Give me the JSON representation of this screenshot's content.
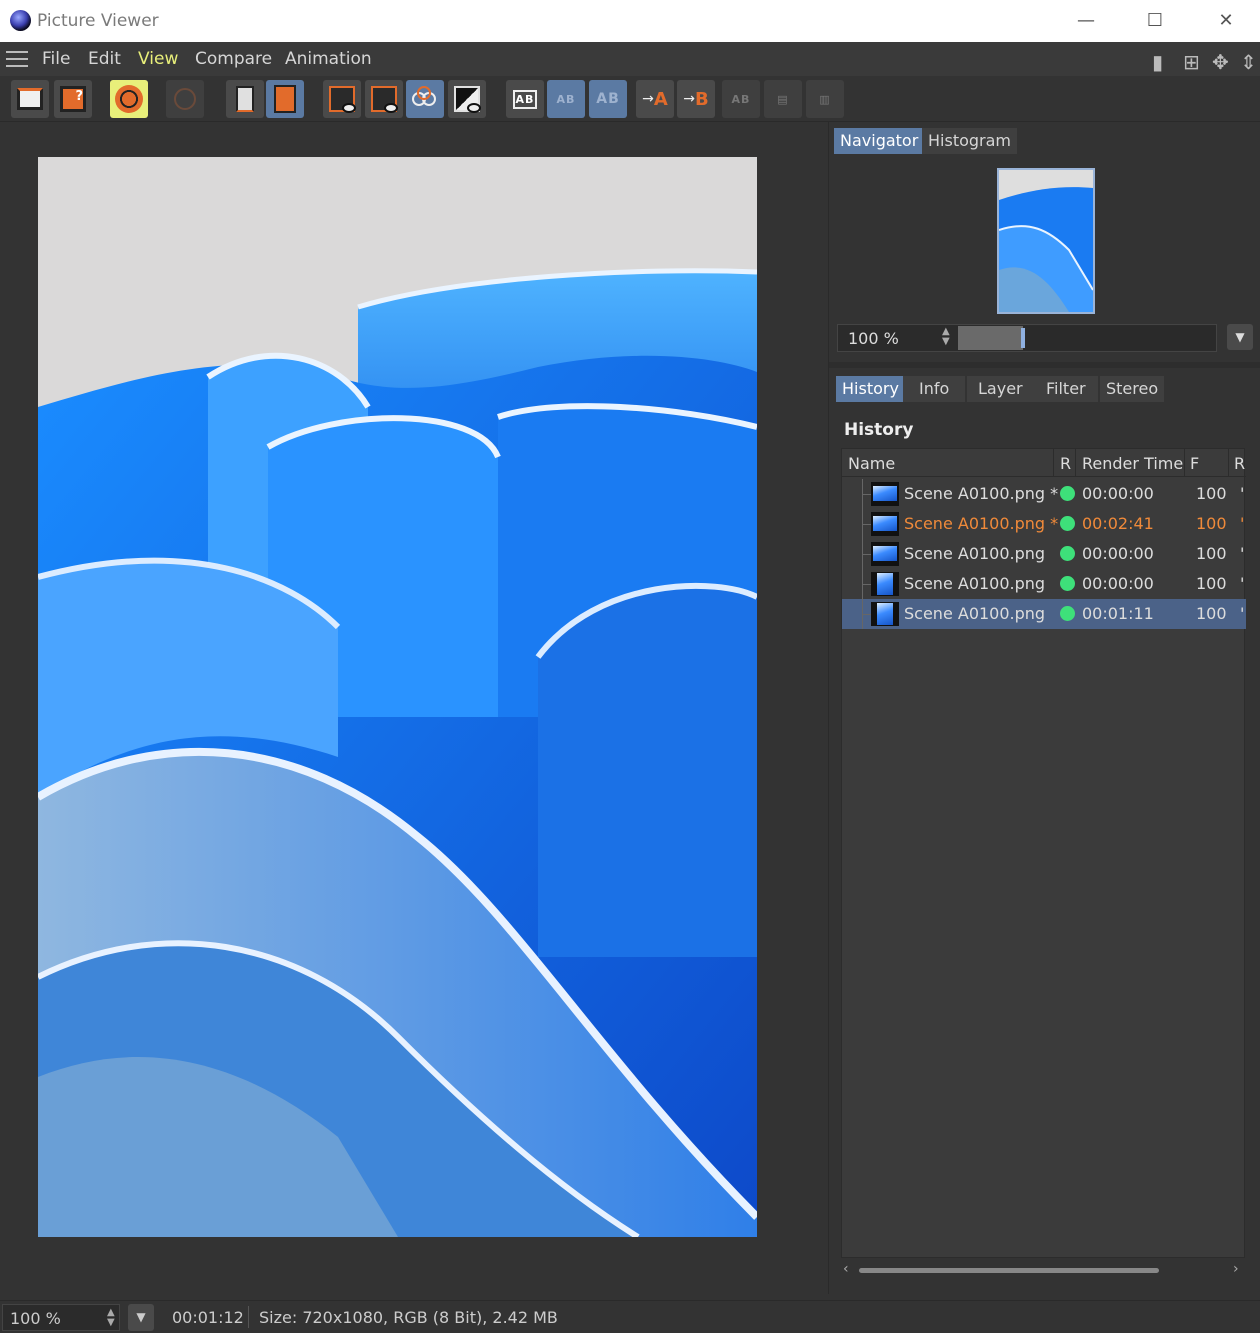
{
  "window": {
    "title": "Picture Viewer",
    "minimize": "—",
    "maximize": "☐",
    "close": "✕"
  },
  "menu": [
    "File",
    "Edit",
    "View",
    "Compare",
    "Animation"
  ],
  "menu_active": "View",
  "navigator": {
    "tabs": [
      "Navigator",
      "Histogram"
    ],
    "active_tab": "Navigator",
    "zoom": "100 %",
    "zoom_fraction": 0.25
  },
  "history_panel": {
    "tabs": [
      "History",
      "Info",
      "Layer",
      "Filter",
      "Stereo"
    ],
    "active_tab": "History",
    "heading": "History",
    "columns": [
      "Name",
      "R",
      "Render Time",
      "F",
      "R"
    ],
    "rows": [
      {
        "name": "Scene A0100.png *",
        "render_time": "00:00:00",
        "f": "100",
        "status": "green",
        "style": "normal",
        "thumb": "landscape"
      },
      {
        "name": "Scene A0100.png *",
        "render_time": "00:02:41",
        "f": "100",
        "status": "green",
        "style": "orange",
        "thumb": "landscape"
      },
      {
        "name": "Scene A0100.png",
        "render_time": "00:00:00",
        "f": "100",
        "status": "green",
        "style": "normal",
        "thumb": "landscape"
      },
      {
        "name": "Scene A0100.png",
        "render_time": "00:00:00",
        "f": "100",
        "status": "green",
        "style": "normal",
        "thumb": "portrait"
      },
      {
        "name": "Scene A0100.png",
        "render_time": "00:01:11",
        "f": "100",
        "status": "green",
        "style": "selected",
        "thumb": "portrait"
      }
    ]
  },
  "status": {
    "zoom": "100 %",
    "time": "00:01:12",
    "info": "Size: 720x1080, RGB (8 Bit), 2.42 MB"
  },
  "colors": {
    "accent": "#5b7aa3",
    "highlight": "#e8ef7a",
    "orange": "#e26b2b",
    "status_green": "#3ee07a"
  },
  "toolbar_icons": [
    "open-icon",
    "save-as-icon",
    "render-settings-icon",
    "stop-icon",
    "delete-icon",
    "filmstrip-icon",
    "view-single-icon",
    "view-double-icon",
    "view-channels-icon",
    "view-alpha-icon",
    "ab-compare-icon",
    "ab-split-icon",
    "ab-overlay-icon",
    "set-a-icon",
    "set-b-icon",
    "ab-swap-icon",
    "ab-horizontal-icon",
    "ab-vertical-icon"
  ]
}
